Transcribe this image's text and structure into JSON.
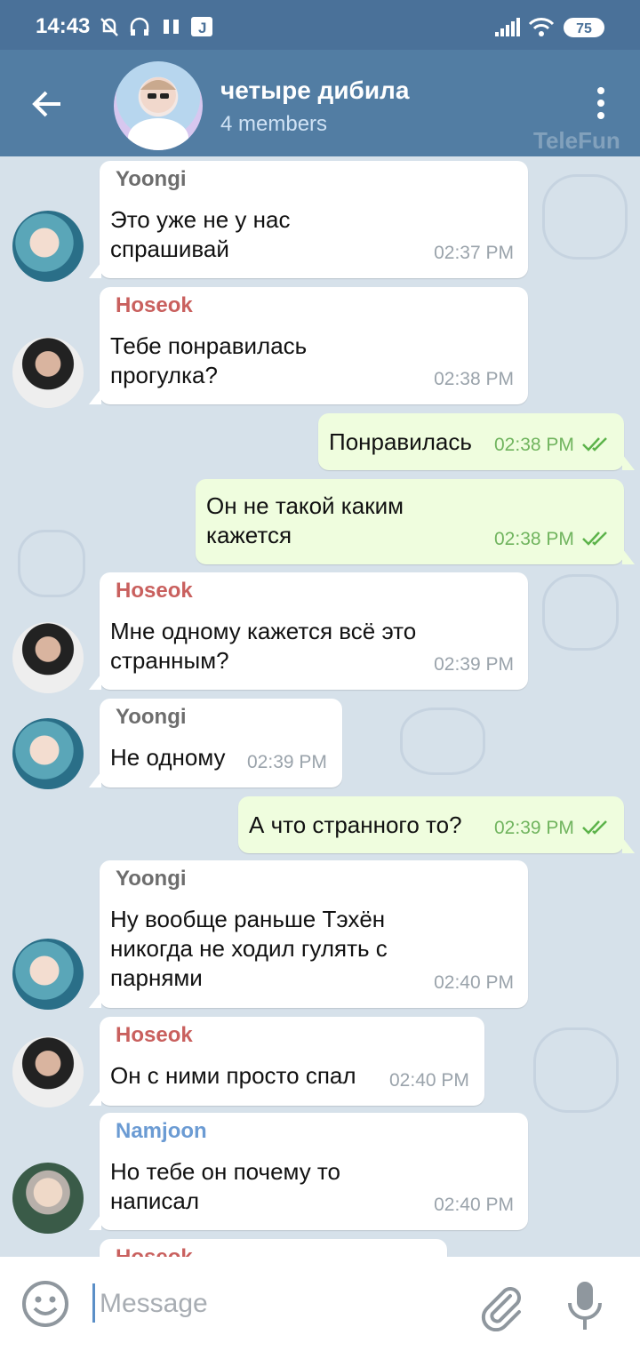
{
  "status": {
    "time": "14:43",
    "battery": "75"
  },
  "header": {
    "title": "четыре дибила",
    "subtitle": "4 members",
    "watermark": "TeleFun"
  },
  "colors": {
    "header": "#527da3",
    "status_bar": "#4a7199",
    "outgoing_bubble": "#effdde",
    "yoongi": "#6d6d6d",
    "hoseok": "#c9605e",
    "namjoon": "#6b9bd3",
    "read_check": "#5cb34a"
  },
  "messages": [
    {
      "sender": "Yoongi",
      "text": "Это уже не у нас\nспрашивай",
      "time": "02:37 PM",
      "direction": "in"
    },
    {
      "sender": "Hoseok",
      "text": "Тебе понравилась\nпрогулка?",
      "time": "02:38 PM",
      "direction": "in"
    },
    {
      "sender": "",
      "text": "Понравилась",
      "time": "02:38 PM",
      "direction": "out",
      "read": true
    },
    {
      "sender": "",
      "text": "Он не такой каким\nкажется",
      "time": "02:38 PM",
      "direction": "out",
      "read": true
    },
    {
      "sender": "Hoseok",
      "text": "Мне одному кажется всё это\nстранным?",
      "time": "02:39 PM",
      "direction": "in"
    },
    {
      "sender": "Yoongi",
      "text": "Не одному",
      "time": "02:39 PM",
      "direction": "in"
    },
    {
      "sender": "",
      "text": "А что странного то?",
      "time": "02:39 PM",
      "direction": "out",
      "read": true
    },
    {
      "sender": "Yoongi",
      "text": "Ну вообще раньше Тэхён\nникогда не ходил гулять с\nпарнями",
      "time": "02:40 PM",
      "direction": "in"
    },
    {
      "sender": "Hoseok",
      "text": "Он с ними просто спал",
      "time": "02:40 PM",
      "direction": "in"
    },
    {
      "sender": "Namjoon",
      "text": "Но тебе он почему то\nнаписал",
      "time": "02:40 PM",
      "direction": "in"
    },
    {
      "sender": "Hoseok",
      "text": "",
      "time": "",
      "direction": "in"
    }
  ],
  "input": {
    "placeholder": "Message"
  }
}
